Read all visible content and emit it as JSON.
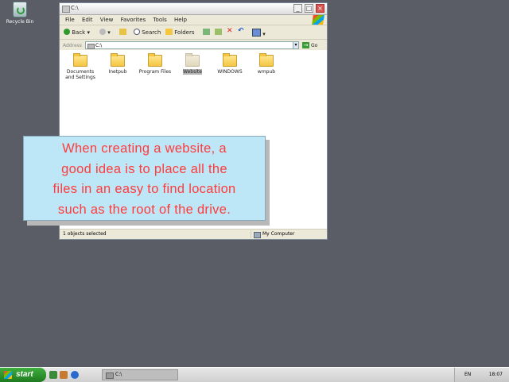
{
  "desktop": {
    "icons": [
      {
        "label": "Recycle Bin",
        "icon": "recycle-bin-icon"
      }
    ]
  },
  "window": {
    "title": "C:\\",
    "menu": [
      "File",
      "Edit",
      "View",
      "Favorites",
      "Tools",
      "Help"
    ],
    "toolbar": {
      "back_label": "Back",
      "search_label": "Search",
      "folders_label": "Folders"
    },
    "address": {
      "label": "Address",
      "value": "C:\\",
      "go_label": "Go"
    },
    "folders": [
      {
        "name": "Documents and Settings",
        "line1": "Documents",
        "line2": "and Settings",
        "selected": false
      },
      {
        "name": "Inetpub",
        "line1": "Inetpub",
        "line2": "",
        "selected": false
      },
      {
        "name": "Program Files",
        "line1": "Program Files",
        "line2": "",
        "selected": false
      },
      {
        "name": "Website",
        "line1": "Website",
        "line2": "",
        "selected": true
      },
      {
        "name": "WINDOWS",
        "line1": "WINDOWS",
        "line2": "",
        "selected": false
      },
      {
        "name": "wmpub",
        "line1": "wmpub",
        "line2": "",
        "selected": false
      }
    ],
    "status": {
      "left": "1 objects selected",
      "right": "My Computer"
    }
  },
  "callout": {
    "lines": [
      "When creating a website, a",
      "good idea is to place all the",
      "files in an easy to find location",
      "such as the root of the drive."
    ]
  },
  "taskbar": {
    "start_label": "start",
    "task_label": "C:\\",
    "language": "EN",
    "clock": "18:07"
  },
  "colors": {
    "callout_bg": "#bde6f7",
    "callout_text": "#ff3b3b",
    "desktop": "#5a5c66"
  }
}
